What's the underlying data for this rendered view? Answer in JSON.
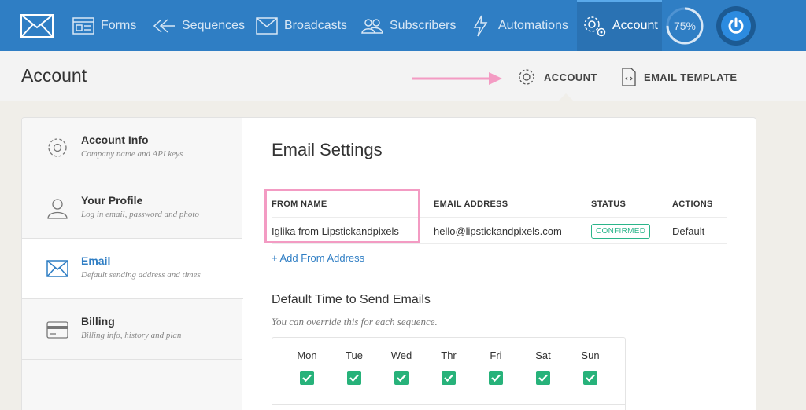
{
  "nav": {
    "items": [
      {
        "label": "Forms",
        "icon": "forms-icon"
      },
      {
        "label": "Sequences",
        "icon": "sequences-icon"
      },
      {
        "label": "Broadcasts",
        "icon": "broadcasts-icon"
      },
      {
        "label": "Subscribers",
        "icon": "subscribers-icon"
      },
      {
        "label": "Automations",
        "icon": "automations-icon"
      },
      {
        "label": "Account",
        "icon": "account-gear-icon",
        "active": true
      }
    ],
    "progress_label": "75%",
    "progress_value": 0.75,
    "colors": {
      "bar": "#2f7ec4",
      "active": "#2a72b3"
    }
  },
  "header": {
    "title": "Account",
    "tabs": [
      {
        "label": "ACCOUNT",
        "icon": "gear-icon"
      },
      {
        "label": "EMAIL TEMPLATE",
        "icon": "code-file-icon"
      }
    ]
  },
  "sidebar": {
    "items": [
      {
        "title": "Account Info",
        "subtitle": "Company name and API keys",
        "icon": "gear-icon"
      },
      {
        "title": "Your Profile",
        "subtitle": "Log in email, password and photo",
        "icon": "user-icon"
      },
      {
        "title": "Email",
        "subtitle": "Default sending address and times",
        "icon": "envelope-icon",
        "active": true
      },
      {
        "title": "Billing",
        "subtitle": "Billing info, history and plan",
        "icon": "credit-card-icon"
      }
    ]
  },
  "main": {
    "title": "Email Settings",
    "table": {
      "headers": [
        "FROM NAME",
        "EMAIL ADDRESS",
        "STATUS",
        "ACTIONS"
      ],
      "rows": [
        {
          "from_name": "Iglika from Lipstickandpixels",
          "email": "hello@lipstickandpixels.com",
          "status": "CONFIRMED",
          "action": "Default"
        }
      ]
    },
    "add_link": "+ Add From Address",
    "send_time": {
      "title": "Default Time to Send Emails",
      "hint": "You can override this for each sequence.",
      "days": [
        {
          "label": "Mon",
          "checked": true
        },
        {
          "label": "Tue",
          "checked": true
        },
        {
          "label": "Wed",
          "checked": true
        },
        {
          "label": "Thr",
          "checked": true
        },
        {
          "label": "Fri",
          "checked": true
        },
        {
          "label": "Sat",
          "checked": true
        },
        {
          "label": "Sun",
          "checked": true
        }
      ]
    },
    "colors": {
      "link": "#2f7ec4",
      "confirmed": "#2bb58a",
      "check": "#27b27a",
      "annotation": "#f39bc3"
    }
  }
}
